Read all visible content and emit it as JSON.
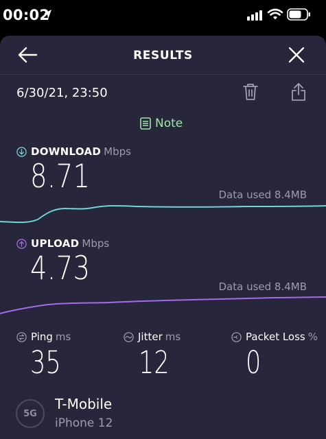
{
  "status_bar": {
    "time": "00:02",
    "icons": [
      "location-arrow-icon",
      "cellular-signal-icon",
      "wifi-icon",
      "battery-icon"
    ]
  },
  "header": {
    "title": "RESULTS",
    "back_icon": "arrow-left-icon",
    "close_icon": "close-icon"
  },
  "result": {
    "date": "6/30/21, 23:50",
    "actions": [
      "trash-icon",
      "share-icon"
    ],
    "note_label": "Note"
  },
  "download": {
    "label": "DOWNLOAD",
    "unit": "Mbps",
    "value": "8.71",
    "data_used": "Data used 8.4MB",
    "color": "#6fd6d8"
  },
  "upload": {
    "label": "UPLOAD",
    "unit": "Mbps",
    "value": "4.73",
    "data_used": "Data used 8.4MB",
    "color": "#a66bea"
  },
  "ping": {
    "label": "Ping",
    "unit": "ms",
    "value": "35"
  },
  "jitter": {
    "label": "Jitter",
    "unit": "ms",
    "value": "12"
  },
  "packet_loss": {
    "label": "Packet Loss",
    "unit": "%",
    "value": "0"
  },
  "network": {
    "badge": "5G",
    "carrier": "T-Mobile",
    "device": "iPhone 12"
  },
  "colors": {
    "background": "#27263a",
    "note": "#9ee6a6",
    "muted": "#9d9caf"
  }
}
